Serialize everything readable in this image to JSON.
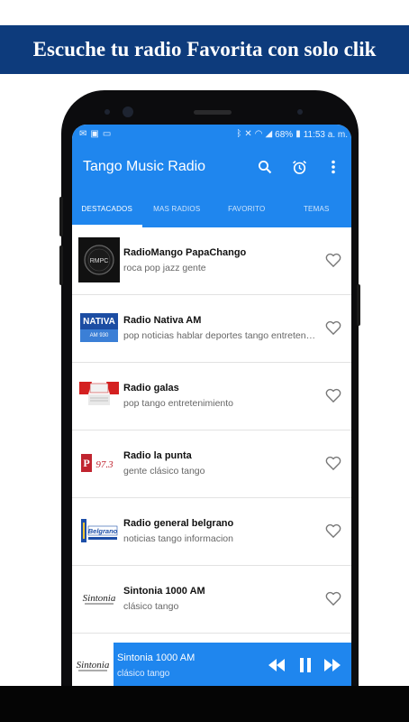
{
  "promo": {
    "text": "Escuche tu radio Favorita con solo clik"
  },
  "status_bar": {
    "battery": "68%",
    "time": "11:53 a. m."
  },
  "app_bar": {
    "title": "Tango Music Radio",
    "icons": [
      "search-icon",
      "alarm-icon",
      "more-vert-icon"
    ]
  },
  "tabs": [
    {
      "label": "DESTACADOS",
      "active": true
    },
    {
      "label": "MAS RADIOS",
      "active": false
    },
    {
      "label": "FAVORITO",
      "active": false
    },
    {
      "label": "TEMAS",
      "active": false
    }
  ],
  "stations": [
    {
      "name": "RadioMango PapaChango",
      "tags": "roca pop jazz gente",
      "logo_text": "RMPC"
    },
    {
      "name": "Radio Nativa AM",
      "tags": "pop noticias hablar deportes tango entretenimiento",
      "logo_text": "NATIVA",
      "logo_sub": "AM 930"
    },
    {
      "name": "Radio galas",
      "tags": "pop tango entretenimiento",
      "logo_text": ""
    },
    {
      "name": "Radio la punta",
      "tags": "gente clásico tango",
      "logo_text": "97.3"
    },
    {
      "name": "Radio general belgrano",
      "tags": "noticias tango informacion",
      "logo_text": "Belgrano"
    },
    {
      "name": "Sintonia 1000 AM",
      "tags": "clásico tango",
      "logo_text": "Sintonia"
    }
  ],
  "player": {
    "title": "Sintonia 1000 AM",
    "subtitle": "clásico tango",
    "logo_text": "Sintonia"
  },
  "colors": {
    "primary": "#1f86ee",
    "banner": "#0d3b7c",
    "phone_body": "#0c0c0e"
  }
}
